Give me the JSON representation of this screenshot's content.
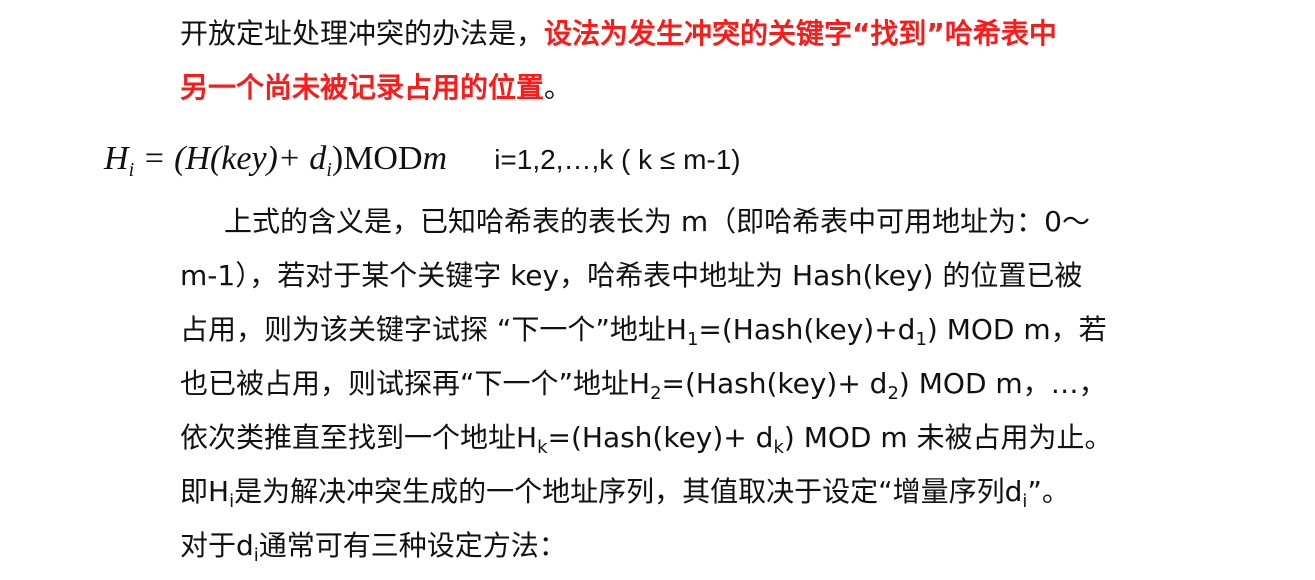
{
  "intro": {
    "text_before": "开放定址处理冲突的办法是，",
    "highlight_part1": "设法为发生冲突的关键字“找到”哈希表中",
    "highlight_part2": "另一个尚未被记录占用的位置",
    "text_after": "。"
  },
  "formula": {
    "H": "H",
    "i": "i",
    "eq_open": " = (H(key)+ d",
    "di_sub": "i",
    "close": ")MOD",
    "m": "m",
    "condition": "i=1,2,…,k ( k ≤ m-1)"
  },
  "para": {
    "l1": "上式的含义是，已知哈希表的表长为 m（即哈希表中可用地址为：0～",
    "l2": "m-1），若对于某个关键字 key，哈希表中地址为 Hash(key) 的位置已被",
    "l3a": "占用，则为该关键字试探 “下一个”地址H",
    "l3s1": "1",
    "l3b": "=(Hash(key)+d",
    "l3s2": "1",
    "l3c": ") MOD m，若",
    "l4a": "也已被占用，则试探再“下一个”地址H",
    "l4s1": "2",
    "l4b": "=(Hash(key)+ d",
    "l4s2": "2",
    "l4c": ") MOD m，…，",
    "l5a": "依次类推直至找到一个地址H",
    "l5s1": "k",
    "l5b": "=(Hash(key)+ d",
    "l5s2": "k",
    "l5c": ") MOD m 未被占用为止。",
    "l6a": "即H",
    "l6s1": "i",
    "l6b": "是为解决冲突生成的一个地址序列，其值取决于设定“增量序列d",
    "l6s2": "i",
    "l6c": "”。",
    "l7a": "对于d",
    "l7s1": "i",
    "l7b": "通常可有三种设定方法："
  }
}
